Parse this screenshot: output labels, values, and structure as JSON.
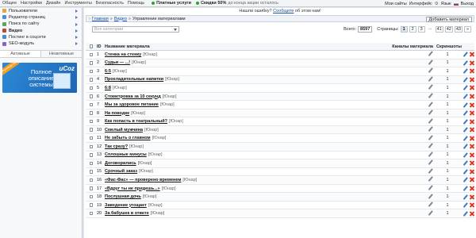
{
  "topbar": {
    "nav": [
      "Общее",
      "Настройки",
      "Дизайн",
      "Инструменты",
      "Безопасность",
      "Помощь"
    ],
    "paid": {
      "label": "Платные услуги",
      "discount_label": "Скидки 50%",
      "discount_note": "до конца акции осталось"
    },
    "right": {
      "my_sites": "Мои сайты",
      "interface": "Интерфейс",
      "language": "Язык",
      "logout": "Выход"
    }
  },
  "sidebar": {
    "items": [
      {
        "label": "Пользователи",
        "icon": "users-icon",
        "bold": false
      },
      {
        "label": "Редактор страниц",
        "icon": "page-editor-icon",
        "bold": false
      },
      {
        "label": "Поиск по сайту",
        "icon": "search-icon",
        "bold": false
      },
      {
        "label": "Видео",
        "icon": "video-icon",
        "bold": true
      },
      {
        "label": "Постинг в соцсети",
        "icon": "social-posting-icon",
        "bold": false
      },
      {
        "label": "SEO-модуль",
        "icon": "seo-icon",
        "bold": false
      }
    ],
    "tabs": [
      "Активные",
      "Неактивные"
    ],
    "banner": {
      "text": "Полное описание системы",
      "logo": "uCoz",
      "stripe": "Руководство"
    }
  },
  "main": {
    "note": {
      "prefix": "Нашли ошибку?",
      "link": "Сообщите",
      "suffix": "об этом нам!"
    },
    "breadcrumb": [
      "Главная",
      "Видео",
      "Управление материалами"
    ],
    "add_button": "Добавить материал",
    "category_placeholder": "Все категории",
    "total_label": "Всего:",
    "total_value": "8597",
    "pages_label": "Страницы:",
    "pages": [
      "1",
      "2",
      "3",
      "...",
      "41",
      "42",
      "43",
      "»"
    ],
    "current_page": "1",
    "columns": {
      "id": "ID",
      "name": "Название материала",
      "channels": "Каналы материала",
      "screenshots": "Скриншоты"
    },
    "tag": "[Юнар]",
    "rows": [
      {
        "id": "1",
        "name": "Стенка на стенку",
        "tag": "[Юнар]",
        "screens": "1"
      },
      {
        "id": "2",
        "name": "Судьи — ...!",
        "tag": "[Юнар]",
        "screens": "1"
      },
      {
        "id": "3",
        "name": "6:5",
        "tag": "[Юнар]",
        "screens": "1"
      },
      {
        "id": "4",
        "name": "Прохладительные напитки",
        "tag": "[Юнар]",
        "screens": "1"
      },
      {
        "id": "5",
        "name": "6:8",
        "tag": "[Юнар]",
        "screens": "1"
      },
      {
        "id": "6",
        "name": "Стометровка за 10 секунд",
        "tag": "[Юнар]",
        "screens": "1"
      },
      {
        "id": "7",
        "name": "Мы за здоровое питание",
        "tag": "[Юнар]",
        "screens": "1"
      },
      {
        "id": "8",
        "name": "На поводке",
        "tag": "[Юнар]",
        "screens": "1"
      },
      {
        "id": "9",
        "name": "Как попасть в театральный?",
        "tag": "[Юнар]",
        "screens": "1"
      },
      {
        "id": "10",
        "name": "Смелый мужчина",
        "tag": "[Юнар]",
        "screens": "1"
      },
      {
        "id": "11",
        "name": "Не забыть о главном",
        "tag": "[Юнар]",
        "screens": "1"
      },
      {
        "id": "12",
        "name": "Так сразу?",
        "tag": "[Юнар]",
        "screens": "1"
      },
      {
        "id": "13",
        "name": "Сплошные минусы",
        "tag": "[Юнар]",
        "screens": "1"
      },
      {
        "id": "14",
        "name": "Договорились",
        "tag": "[Юнар]",
        "screens": "1"
      },
      {
        "id": "15",
        "name": "Срочный заказ",
        "tag": "[Юнар]",
        "screens": "1"
      },
      {
        "id": "16",
        "name": "«Фас-Фас» — проверено временем",
        "tag": "[Юнар]",
        "screens": "1"
      },
      {
        "id": "17",
        "name": "«Вдруг ты не придешь...»",
        "tag": "[Юнар]",
        "screens": "1"
      },
      {
        "id": "18",
        "name": "Послушная дочь",
        "tag": "[Юнар]",
        "screens": "1"
      },
      {
        "id": "19",
        "name": "Заведение угощает",
        "tag": "[Юнар]",
        "screens": "1"
      },
      {
        "id": "20",
        "name": "За бабушек в ответе",
        "tag": "[Юнар]",
        "screens": "1"
      }
    ]
  },
  "colors": {
    "accent": "#1a52a6",
    "delete": "#d9391e",
    "paid_dot": "#2aa52a"
  }
}
